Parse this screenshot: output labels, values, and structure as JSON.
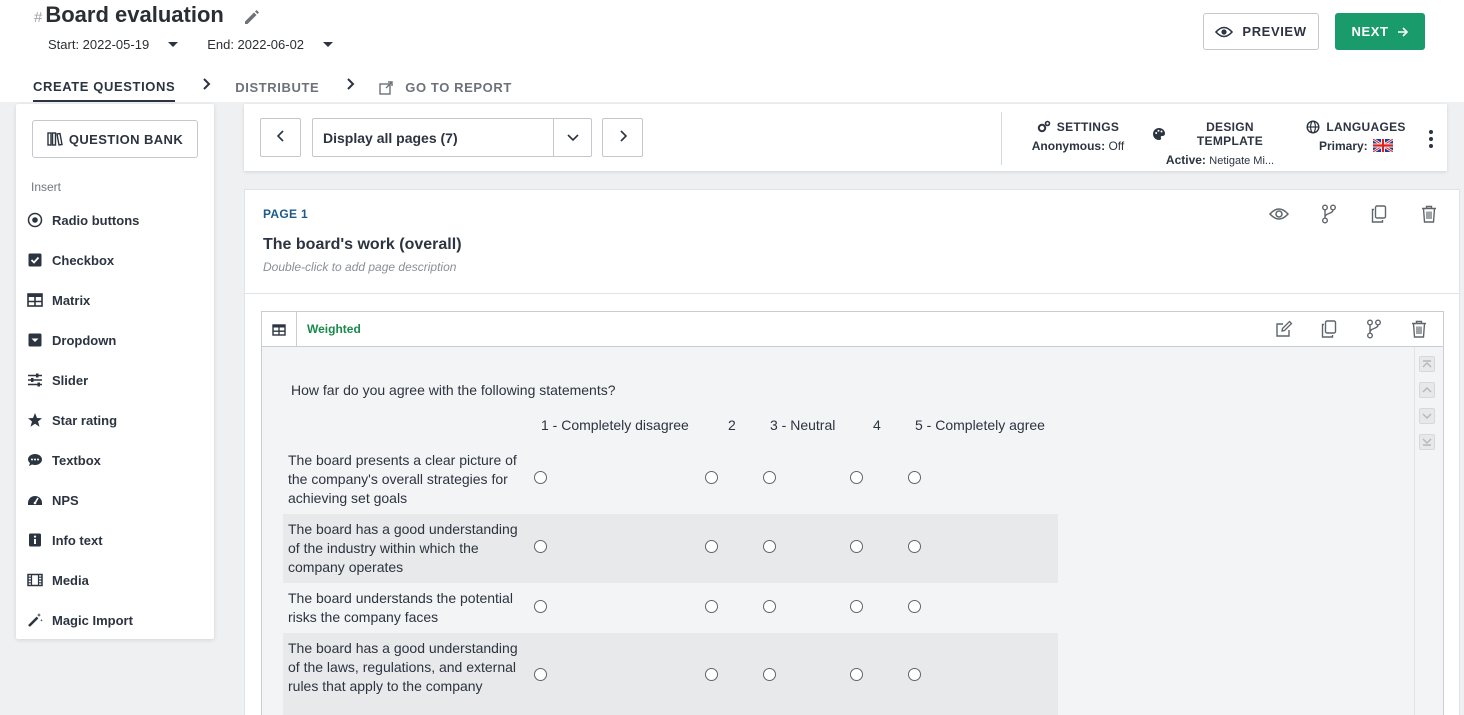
{
  "header": {
    "hash": "#",
    "title": "Board evaluation",
    "start": "Start: 2022-05-19",
    "end": "End: 2022-06-02",
    "steps": {
      "create": "CREATE QUESTIONS",
      "distribute": "DISTRIBUTE",
      "report": "GO TO REPORT"
    },
    "preview_label": "PREVIEW",
    "next_label": "NEXT",
    "accent_color": "#1a9b6c"
  },
  "sidebar": {
    "question_bank": "QUESTION BANK",
    "insert_label": "Insert",
    "items": [
      {
        "label": "Radio buttons",
        "icon": "radio-icon"
      },
      {
        "label": "Checkbox",
        "icon": "checkbox-icon"
      },
      {
        "label": "Matrix",
        "icon": "matrix-icon"
      },
      {
        "label": "Dropdown",
        "icon": "dropdown-icon"
      },
      {
        "label": "Slider",
        "icon": "slider-icon"
      },
      {
        "label": "Star rating",
        "icon": "star-icon"
      },
      {
        "label": "Textbox",
        "icon": "textbox-icon"
      },
      {
        "label": "NPS",
        "icon": "gauge-icon"
      },
      {
        "label": "Info text",
        "icon": "info-icon"
      },
      {
        "label": "Media",
        "icon": "film-icon"
      },
      {
        "label": "Magic Import",
        "icon": "magic-wand-icon"
      }
    ]
  },
  "toolbar": {
    "page_select": "Display all pages (7)",
    "settings": {
      "title": "SETTINGS",
      "key": "Anonymous:",
      "value": "Off"
    },
    "design": {
      "title": "DESIGN TEMPLATE",
      "key": "Active:",
      "value": "Netigate Mi..."
    },
    "languages": {
      "title": "LANGUAGES",
      "key": "Primary:",
      "flag": "uk-flag-icon"
    }
  },
  "page": {
    "label": "PAGE 1",
    "title": "The board's work (overall)",
    "description": "Double-click to add page description"
  },
  "question": {
    "tag": "Weighted",
    "tag_color": "#1a8a4c",
    "text": "How far do you agree with the following statements?",
    "columns": [
      "1 - Completely disagree",
      "2",
      "3 - Neutral",
      "4",
      "5 - Completely agree"
    ],
    "rows": [
      "The board presents a clear picture of the company's overall strategies for achieving set goals",
      "The board has a good understanding of the industry within which the company operates",
      "The board understands the potential risks the company faces",
      "The board has a good understanding of the laws, regulations, and external rules that apply to the company"
    ]
  }
}
